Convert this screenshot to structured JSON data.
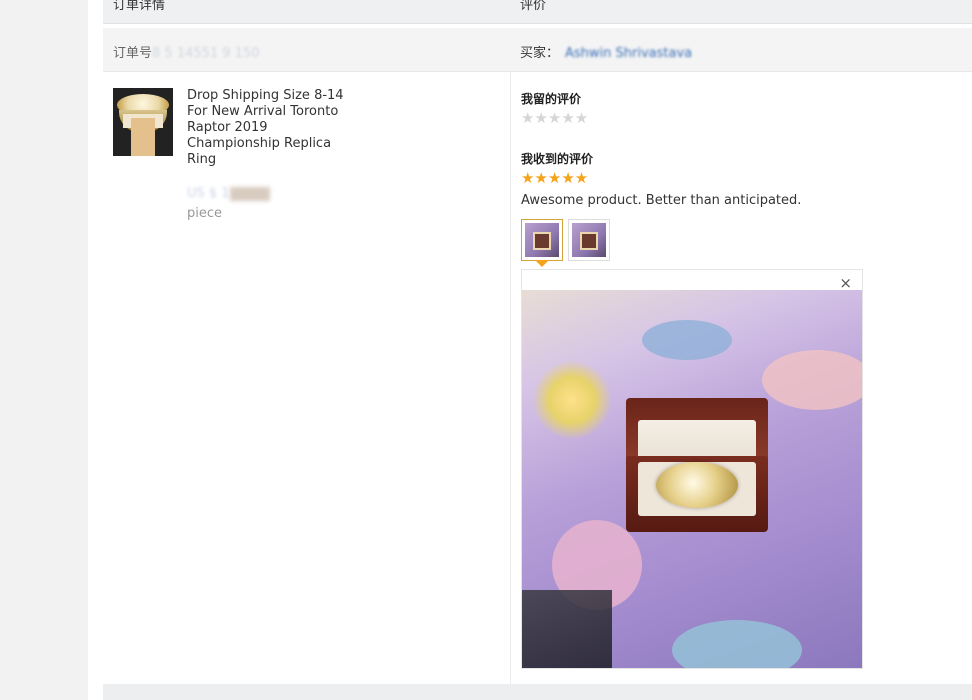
{
  "header": {
    "col_order": "订单详情",
    "col_review": "评价"
  },
  "order": {
    "label": "订单号",
    "number_obscured": "8 5 14551 9 150",
    "buyer_label": "买家：",
    "buyer_name_obscured": "Ashwin Shrivastava"
  },
  "product": {
    "title": "Drop Shipping Size 8-14 For New Arrival Toronto Raptor 2019 Championship Replica Ring",
    "quantity_obscured": "US $ 1",
    "quantity_unit": "piece"
  },
  "review": {
    "my_review_label": "我留的评价",
    "my_rating": 0,
    "received_review_label": "我收到的评价",
    "received_rating": 5,
    "comment": "Awesome product. Better than anticipated.",
    "star_glyph": "★★★★★",
    "close_glyph": "×"
  },
  "colors": {
    "star_gold": "#f5a31a",
    "star_grey": "#d6d6d6",
    "link_blue": "#3a6fb7"
  }
}
